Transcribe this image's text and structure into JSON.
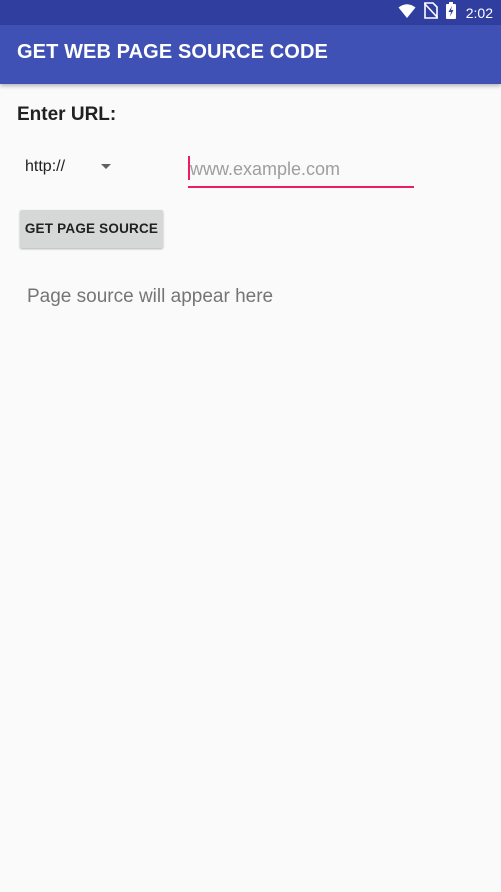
{
  "status_bar": {
    "time": "2:02",
    "icons": [
      "wifi-icon",
      "no-sim-icon",
      "battery-charging-icon"
    ],
    "background_color": "#303f9f"
  },
  "app_bar": {
    "title": "GET WEB PAGE SOURCE CODE",
    "background_color": "#3f51b5"
  },
  "form": {
    "url_label": "Enter URL:",
    "protocol_selected": "http://",
    "url_placeholder": "www.example.com",
    "url_value": "",
    "accent_color": "#e91e63",
    "button_label": "GET PAGE SOURCE"
  },
  "output": {
    "placeholder_text": "Page source will appear here"
  }
}
